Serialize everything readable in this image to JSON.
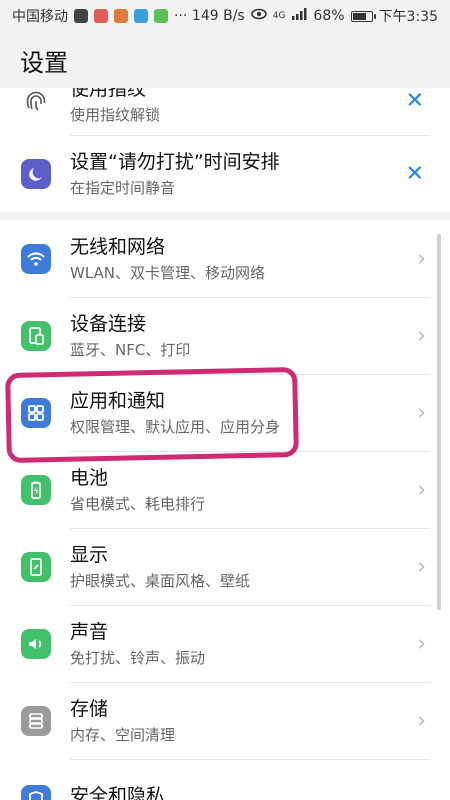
{
  "status_bar": {
    "carrier": "中国移动",
    "speed": "149 B/s",
    "signal": "4G",
    "battery": "68%",
    "time": "下午3:35",
    "dots": "···"
  },
  "header": {
    "title": "设置"
  },
  "top_items": [
    {
      "title": "使用指纹",
      "subtitle": "使用指纹解锁",
      "action": "✕",
      "icon": "fingerprint-icon"
    },
    {
      "title": "设置“请勿打扰”时间安排",
      "subtitle": "在指定时间静音",
      "action": "✕",
      "icon": "moon-icon"
    }
  ],
  "main_items": [
    {
      "title": "无线和网络",
      "subtitle": "WLAN、双卡管理、移动网络",
      "icon": "wifi-icon",
      "color": "#3f7bd9"
    },
    {
      "title": "设备连接",
      "subtitle": "蓝牙、NFC、打印",
      "icon": "device-link-icon",
      "color": "#43c16a"
    },
    {
      "title": "应用和通知",
      "subtitle": "权限管理、默认应用、应用分身",
      "icon": "apps-icon",
      "color": "#3f7bd9"
    },
    {
      "title": "电池",
      "subtitle": "省电模式、耗电排行",
      "icon": "battery-icon",
      "color": "#43c16a"
    },
    {
      "title": "显示",
      "subtitle": "护眼模式、桌面风格、壁纸",
      "icon": "display-icon",
      "color": "#43c16a"
    },
    {
      "title": "声音",
      "subtitle": "免打扰、铃声、振动",
      "icon": "sound-icon",
      "color": "#43c16a"
    },
    {
      "title": "存储",
      "subtitle": "内存、空间清理",
      "icon": "storage-icon",
      "color": "#9a9a9a"
    },
    {
      "title": "安全和隐私",
      "subtitle": "",
      "icon": "shield-icon",
      "color": "#3f7bd9"
    }
  ],
  "chevron": "›"
}
